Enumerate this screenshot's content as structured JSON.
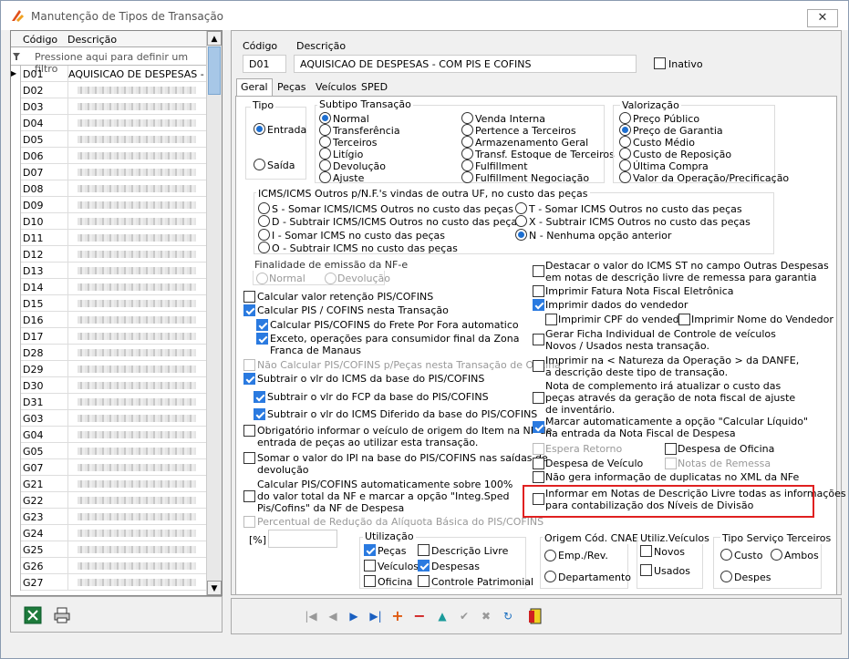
{
  "window": {
    "title": "Manutenção de Tipos de Transação",
    "close": "✕"
  },
  "grid": {
    "col_code": "Código",
    "col_desc": "Descrição",
    "filter_placeholder": "Pressione aqui para definir um filtro",
    "rows": [
      {
        "code": "D01",
        "desc": "AQUISICAO DE DESPESAS - CO"
      },
      {
        "code": "D02"
      },
      {
        "code": "D03"
      },
      {
        "code": "D04"
      },
      {
        "code": "D05"
      },
      {
        "code": "D06"
      },
      {
        "code": "D07"
      },
      {
        "code": "D08"
      },
      {
        "code": "D09"
      },
      {
        "code": "D10"
      },
      {
        "code": "D11"
      },
      {
        "code": "D12"
      },
      {
        "code": "D13"
      },
      {
        "code": "D14"
      },
      {
        "code": "D15"
      },
      {
        "code": "D16"
      },
      {
        "code": "D17"
      },
      {
        "code": "D28"
      },
      {
        "code": "D29"
      },
      {
        "code": "D30"
      },
      {
        "code": "D31"
      },
      {
        "code": "G03"
      },
      {
        "code": "G04"
      },
      {
        "code": "G05"
      },
      {
        "code": "G07"
      },
      {
        "code": "G21"
      },
      {
        "code": "G22"
      },
      {
        "code": "G23"
      },
      {
        "code": "G24"
      },
      {
        "code": "G25"
      },
      {
        "code": "G26"
      },
      {
        "code": "G27"
      }
    ]
  },
  "header": {
    "code_label": "Código",
    "desc_label": "Descrição",
    "code_value": "D01",
    "desc_value": "AQUISICAO DE DESPESAS - COM PIS E COFINS",
    "inactive_label": "Inativo"
  },
  "tabs": [
    "Geral",
    "Peças",
    "Veículos",
    "SPED"
  ],
  "tipo": {
    "label": "Tipo",
    "entrada": "Entrada",
    "saida": "Saída"
  },
  "subtipo": {
    "label": "Subtipo Transação",
    "items": [
      "Normal",
      "Transferência",
      "Terceiros",
      "Litígio",
      "Devolução",
      "Ajuste",
      "Venda Interna",
      "Pertence a Terceiros",
      "Armazenamento Geral",
      "Transf. Estoque de Terceiros",
      "Fulfillment",
      "Fulfillment Negociação"
    ]
  },
  "valorizacao": {
    "label": "Valorização",
    "items": [
      "Preço Público",
      "Preço de Garantia",
      "Custo Médio",
      "Custo de Reposição",
      "Última Compra",
      "Valor da Operação/Precificação"
    ]
  },
  "icms": {
    "label": "ICMS/ICMS Outros p/N.F.'s vindas de outra UF, no custo das peças",
    "items": [
      "S - Somar ICMS/ICMS Outros no custo das peças",
      "D - Subtrair ICMS/ICMS Outros no custo das peças",
      "I - Somar ICMS no custo das peças",
      "O - Subtrair ICMS no custo das peças",
      "T - Somar ICMS Outros no custo das peças",
      "X - Subtrair ICMS Outros no custo das peças",
      "N - Nenhuma opção anterior"
    ]
  },
  "finalidade": {
    "label": "Finalidade de emissão da NF-e",
    "normal": "Normal",
    "devolucao": "Devolução"
  },
  "left_checks": [
    "Calcular valor retenção PIS/COFINS",
    "Calcular PIS / COFINS nesta Transação",
    "Calcular PIS/COFINS do Frete Por Fora automatico",
    "Exceto, operações para consumidor final da Zona",
    "Franca de Manaus",
    "Não Calcular PIS/COFINS p/Peças nesta Transação de Oficina",
    "Subtrair o vlr do ICMS da base do PIS/COFINS",
    "Subtrair o vlr do FCP da base do PIS/COFINS",
    "Subtrair o vlr do ICMS Diferido da base do PIS/COFINS",
    "Obrigatório informar o veículo de origem do Item na NF de",
    "entrada de peças ao utilizar esta transação.",
    "Somar o valor do IPI na base do PIS/COFINS nas saídas de",
    "devolução",
    "Calcular PIS/COFINS automaticamente sobre 100%",
    "do valor total da NF e marcar a opção \"Integ.Sped",
    "Pis/Cofins\" da NF de Despesa",
    "Percentual de Redução da Alíquota Básica do PIS/COFINS",
    "[%]"
  ],
  "right_checks": [
    "Destacar o valor do ICMS ST no campo Outras Despesas",
    "em notas de descrição livre de remessa para garantia",
    "Imprimir Fatura Nota Fiscal Eletrônica",
    "Imprimir dados do vendedor",
    "Imprimir CPF do vendedor",
    "Imprimir Nome do Vendedor",
    "Gerar Ficha Individual de Controle de veículos",
    "Novos / Usados  nesta transação.",
    "Imprimir na < Natureza da Operação > da DANFE,",
    "a descrição deste tipo de transação.",
    "Nota de complemento irá atualizar o custo das",
    "peças através da geração de nota fiscal de ajuste",
    "de inventário.",
    "Marcar automaticamente a opção \"Calcular Líquido\"",
    "na entrada da Nota Fiscal de Despesa",
    "Espera Retorno",
    "Despesa de Oficina",
    "Despesa de Veículo",
    "Notas de Remessa",
    "Não gera informação de duplicatas no XML da NFe",
    "Informar em Notas de Descrição Livre todas as informações",
    "para contabilização dos Níveis de Divisão"
  ],
  "utilizacao": {
    "label": "Utilização",
    "items": [
      "Peças",
      "Descrição Livre",
      "Veículos",
      "Despesas",
      "Oficina",
      "Controle Patrimonial"
    ]
  },
  "cnae": {
    "label": "Origem Cód. CNAE",
    "items": [
      "Emp./Rev.",
      "Departamento"
    ]
  },
  "utilveic": {
    "label": "Utiliz.Veículos",
    "items": [
      "Novos",
      "Usados"
    ]
  },
  "tipo_serv": {
    "label": "Tipo Serviço Terceiros",
    "items": [
      "Custo",
      "Ambos",
      "Despesa"
    ]
  }
}
